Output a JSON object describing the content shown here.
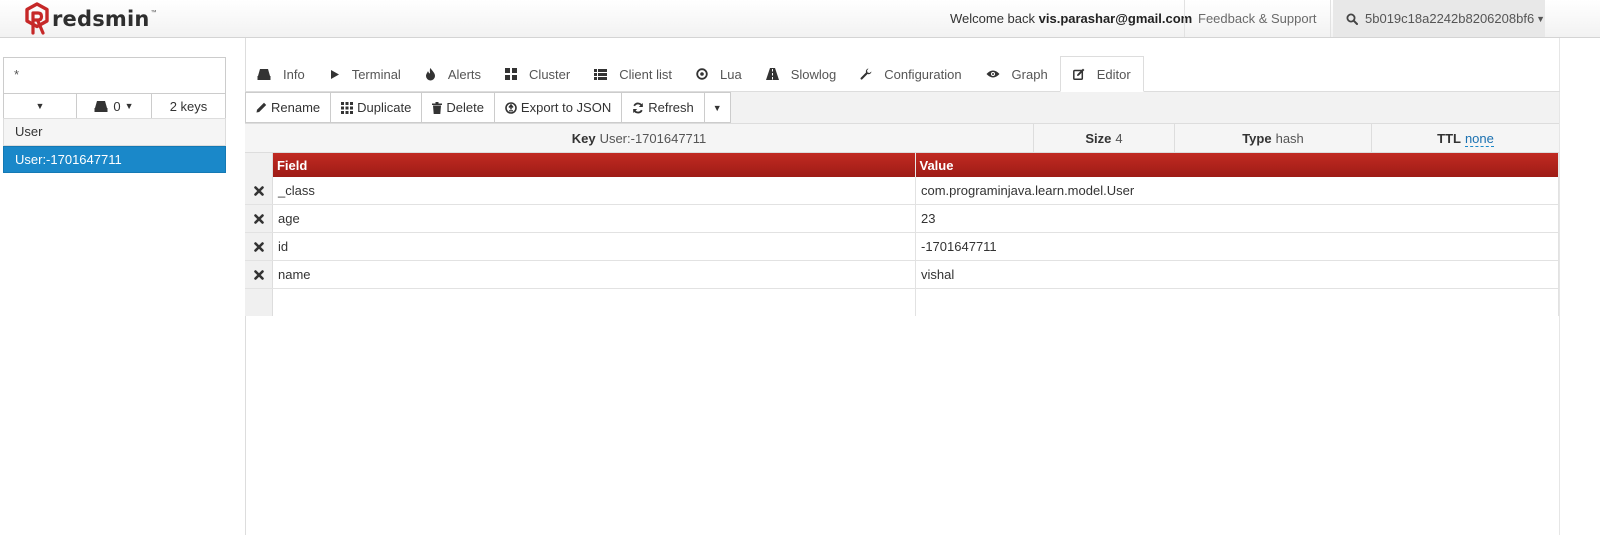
{
  "app": {
    "brand": "redsmin",
    "trademark": "™"
  },
  "navbar": {
    "welcome_prefix": "Welcome back",
    "user_email": "vis.parashar@gmail.com",
    "feedback": "Feedback & Support",
    "instance_id": "5b019c18a2242b8206208bf6"
  },
  "sidebar": {
    "search_value": "*",
    "db_label": "0",
    "key_count": "2 keys",
    "group_label": "User",
    "selected_key": "User:-1701647711"
  },
  "tabs": [
    {
      "label": "Info",
      "icon": "database-icon"
    },
    {
      "label": "Terminal",
      "icon": "play-icon"
    },
    {
      "label": "Alerts",
      "icon": "fire-icon"
    },
    {
      "label": "Cluster",
      "icon": "grid-icon"
    },
    {
      "label": "Client list",
      "icon": "list-icon"
    },
    {
      "label": "Lua",
      "icon": "circle-dot-icon"
    },
    {
      "label": "Slowlog",
      "icon": "road-icon"
    },
    {
      "label": "Configuration",
      "icon": "wrench-icon"
    },
    {
      "label": "Graph",
      "icon": "eye-icon"
    },
    {
      "label": "Editor",
      "icon": "edit-icon",
      "active": true
    }
  ],
  "toolbar": {
    "rename": "Rename",
    "duplicate": "Duplicate",
    "delete": "Delete",
    "export": "Export to JSON",
    "refresh": "Refresh"
  },
  "key_info": {
    "key_label": "Key",
    "key_value": "User:-1701647711",
    "size_label": "Size",
    "size_value": "4",
    "type_label": "Type",
    "type_value": "hash",
    "ttl_label": "TTL",
    "ttl_value": "none"
  },
  "table": {
    "columns": [
      "Field",
      "Value"
    ],
    "rows": [
      {
        "field": "_class",
        "value": "com.programinjava.learn.model.User"
      },
      {
        "field": "age",
        "value": "23"
      },
      {
        "field": "id",
        "value": "-1701647711"
      },
      {
        "field": "name",
        "value": "vishal"
      }
    ]
  },
  "colors": {
    "header_red": "#b0231c",
    "selected_blue": "#1a88c9",
    "brand_red": "#c62828"
  }
}
